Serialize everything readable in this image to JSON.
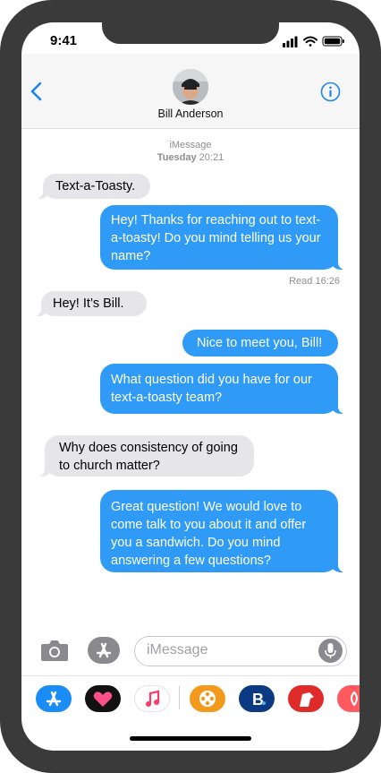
{
  "status_bar": {
    "time": "9:41",
    "icons": [
      "signal-icon",
      "wifi-icon",
      "battery-icon"
    ]
  },
  "header": {
    "contact_name": "Bill Anderson",
    "back_icon": "chevron-left-icon",
    "info_icon": "info-icon"
  },
  "thread": {
    "service": "iMessage",
    "day": "Tuesday",
    "time": "20:21",
    "messages": [
      {
        "direction": "incoming",
        "text": "Text-a-Toasty."
      },
      {
        "direction": "outgoing",
        "text": "Hey! Thanks for reaching out to text-a-toasty! Do you mind telling us your name?"
      },
      {
        "direction": "incoming",
        "text": "Hey! It’s Bill."
      },
      {
        "direction": "outgoing",
        "text": "Nice to meet you, Bill!"
      },
      {
        "direction": "outgoing",
        "text": "What question did you have for our text-a-toasty team?"
      },
      {
        "direction": "incoming",
        "text": "Why does consistency of going to church matter?"
      },
      {
        "direction": "outgoing",
        "text": "Great question! We would love to come talk to you about it and offer you a sandwich. Do you mind answering a few questions?"
      }
    ],
    "read_receipt": "Read 16:26"
  },
  "composer": {
    "placeholder": "iMessage",
    "camera_icon": "camera-icon",
    "apps_icon": "app-store-icon",
    "mic_icon": "microphone-icon"
  },
  "app_tray": {
    "apps": [
      {
        "name": "app-store-icon",
        "color": "#1a8cf5"
      },
      {
        "name": "heart-app-icon",
        "color": "#111111"
      },
      {
        "name": "music-icon",
        "color": "#ffffff"
      },
      {
        "name": "film-reel-icon",
        "color": "#f39a1e"
      },
      {
        "name": "booking-icon",
        "color": "#0b3a82"
      },
      {
        "name": "dog-app-icon",
        "color": "#e02b2b"
      },
      {
        "name": "airbnb-icon",
        "color": "#ff5a60"
      }
    ]
  },
  "colors": {
    "outgoing_bubble": "#2f9bf7",
    "incoming_bubble": "#e5e5ea",
    "accent": "#1a86f0",
    "frame": "#3a3a3a"
  }
}
